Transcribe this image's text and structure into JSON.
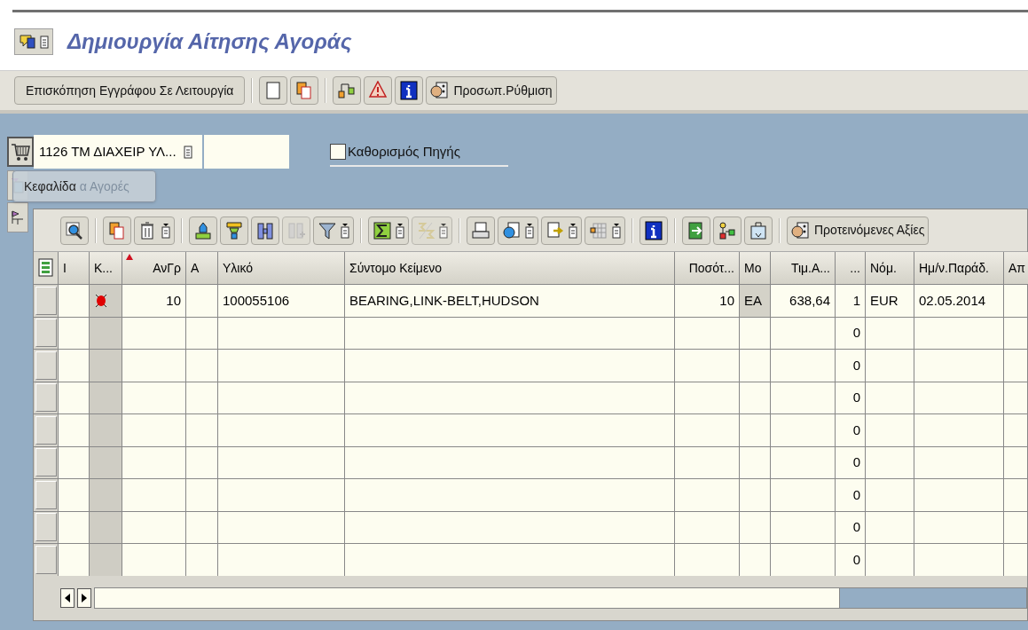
{
  "window": {
    "title": "Δημιουργία Αίτησης Αγοράς"
  },
  "toolbar": {
    "items": [
      {
        "kind": "button",
        "label": "Επισκόπηση Εγγράφου Σε Λειτουργία"
      },
      {
        "kind": "separator"
      },
      {
        "kind": "icon"
      },
      {
        "kind": "icon"
      },
      {
        "kind": "separator"
      },
      {
        "kind": "icon"
      },
      {
        "kind": "icon"
      },
      {
        "kind": "icon"
      },
      {
        "kind": "button",
        "label": "Προσωπ.Ρύθμιση"
      }
    ]
  },
  "header": {
    "field_value": "1126 ΤΜ ΔΙΑΧΕΙΡ ΥΛ...",
    "checkbox": {
      "label": "Καθορισμός Πηγής",
      "checked": false
    },
    "tooltip": "Κεφαλίδα",
    "covered_label": "α Αγορές"
  },
  "grid_toolbar": {
    "items": [
      {
        "kind": "icon",
        "disabled": false
      },
      {
        "kind": "separator"
      },
      {
        "kind": "icon",
        "disabled": false
      },
      {
        "kind": "icon",
        "disabled": false
      },
      {
        "kind": "separator"
      },
      {
        "kind": "icon",
        "disabled": false
      },
      {
        "kind": "icon",
        "disabled": false
      },
      {
        "kind": "icon",
        "disabled": false
      },
      {
        "kind": "icon",
        "disabled": true
      },
      {
        "kind": "icon",
        "disabled": false
      },
      {
        "kind": "separator"
      },
      {
        "kind": "icon",
        "disabled": false
      },
      {
        "kind": "icon",
        "disabled": true
      },
      {
        "kind": "separator"
      },
      {
        "kind": "icon",
        "disabled": false
      },
      {
        "kind": "icon",
        "disabled": false
      },
      {
        "kind": "icon",
        "disabled": false
      },
      {
        "kind": "icon",
        "disabled": false
      },
      {
        "kind": "separator"
      },
      {
        "kind": "icon",
        "disabled": false
      },
      {
        "kind": "separator"
      },
      {
        "kind": "icon",
        "disabled": false
      },
      {
        "kind": "icon",
        "disabled": false
      },
      {
        "kind": "icon",
        "disabled": false
      },
      {
        "kind": "separator"
      },
      {
        "kind": "button",
        "label": "Προτεινόμενες Αξίες",
        "disabled": false
      }
    ]
  },
  "table": {
    "columns": [
      {
        "label": "I",
        "sorted": false
      },
      {
        "label": "Κ...",
        "sorted": false
      },
      {
        "label": "ΑνΓρ",
        "sorted": true
      },
      {
        "label": "Α",
        "sorted": false
      },
      {
        "label": "Υλικό",
        "sorted": false
      },
      {
        "label": "Σύντομο Κείμενο",
        "sorted": false
      },
      {
        "label": "Ποσότ...",
        "sorted": false
      },
      {
        "label": "Μο",
        "sorted": false
      },
      {
        "label": "Τιμ.Α...",
        "sorted": false
      },
      {
        "label": "...",
        "sorted": false
      },
      {
        "label": "Νόμ.",
        "sorted": false
      },
      {
        "label": "Ημ/ν.Παράδ.",
        "sorted": false
      },
      {
        "label": "Απ",
        "sorted": false
      }
    ],
    "rows": [
      {
        "color": "#e00000",
        "cells": [
          "",
          "",
          "10",
          "",
          "100055106",
          "BEARING,LINK-BELT,HUDSON",
          "10",
          "EA",
          "638,64",
          "1",
          "EUR",
          "02.05.2014",
          ""
        ]
      },
      {
        "cells": [
          "",
          "",
          "",
          "",
          "",
          "",
          "",
          "",
          "",
          "0",
          "",
          "",
          ""
        ]
      },
      {
        "cells": [
          "",
          "",
          "",
          "",
          "",
          "",
          "",
          "",
          "",
          "0",
          "",
          "",
          ""
        ]
      },
      {
        "cells": [
          "",
          "",
          "",
          "",
          "",
          "",
          "",
          "",
          "",
          "0",
          "",
          "",
          ""
        ]
      },
      {
        "cells": [
          "",
          "",
          "",
          "",
          "",
          "",
          "",
          "",
          "",
          "0",
          "",
          "",
          ""
        ]
      },
      {
        "cells": [
          "",
          "",
          "",
          "",
          "",
          "",
          "",
          "",
          "",
          "0",
          "",
          "",
          ""
        ]
      },
      {
        "cells": [
          "",
          "",
          "",
          "",
          "",
          "",
          "",
          "",
          "",
          "0",
          "",
          "",
          ""
        ]
      },
      {
        "cells": [
          "",
          "",
          "",
          "",
          "",
          "",
          "",
          "",
          "",
          "0",
          "",
          "",
          ""
        ]
      },
      {
        "cells": [
          "",
          "",
          "",
          "",
          "",
          "",
          "",
          "",
          "",
          "0",
          "",
          "",
          ""
        ]
      }
    ]
  }
}
